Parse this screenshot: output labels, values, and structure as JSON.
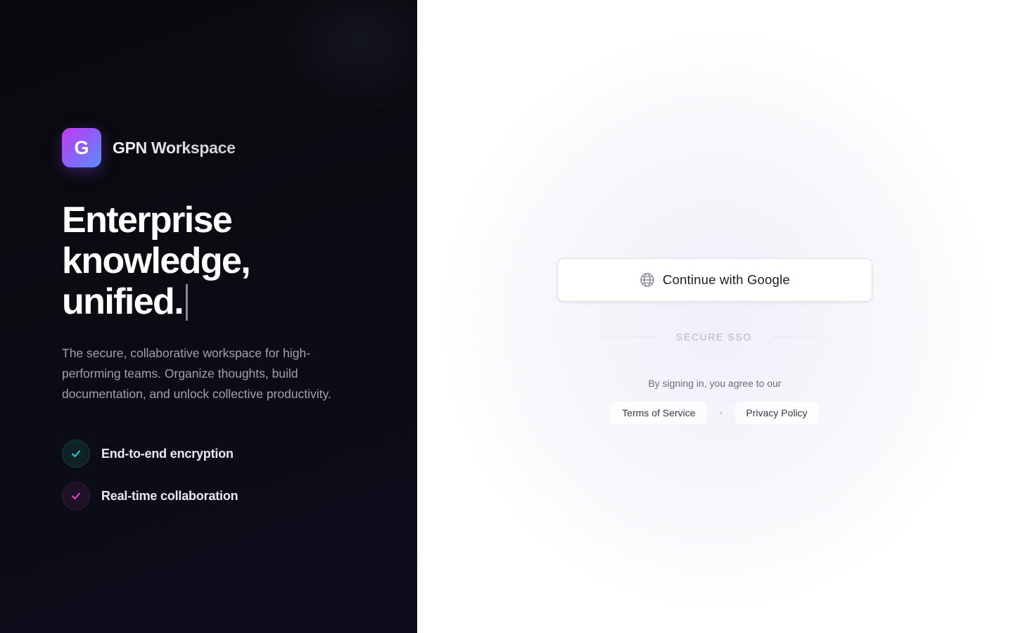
{
  "brand": {
    "logo_letter": "G",
    "name": "GPN Workspace",
    "logo_gradient": [
      "#c13df0",
      "#8f5cf6",
      "#5a8ff5"
    ]
  },
  "hero": {
    "headline_lines": [
      "Enterprise",
      "knowledge,",
      "unified."
    ],
    "description": "The secure, collaborative workspace for high-performing teams. Organize thoughts, build documentation, and unlock collective productivity."
  },
  "features": [
    {
      "label": "End-to-end encryption",
      "icon": "check-icon",
      "accent": "#22d3ee"
    },
    {
      "label": "Real-time collaboration",
      "icon": "check-icon",
      "accent": "#e048d8"
    }
  ],
  "auth": {
    "google_button_label": "Continue with Google",
    "google_button_icon": "globe-icon",
    "divider_text": "SECURE SSO",
    "agreement_text": "By signing in, you agree to our",
    "terms_label": "Terms of Service",
    "privacy_label": "Privacy Policy"
  },
  "colors": {
    "left_background": "#0b0b13",
    "right_background": "#ffffff",
    "text_primary_dark": "#ffffff",
    "text_muted": "#a2a2ad"
  }
}
